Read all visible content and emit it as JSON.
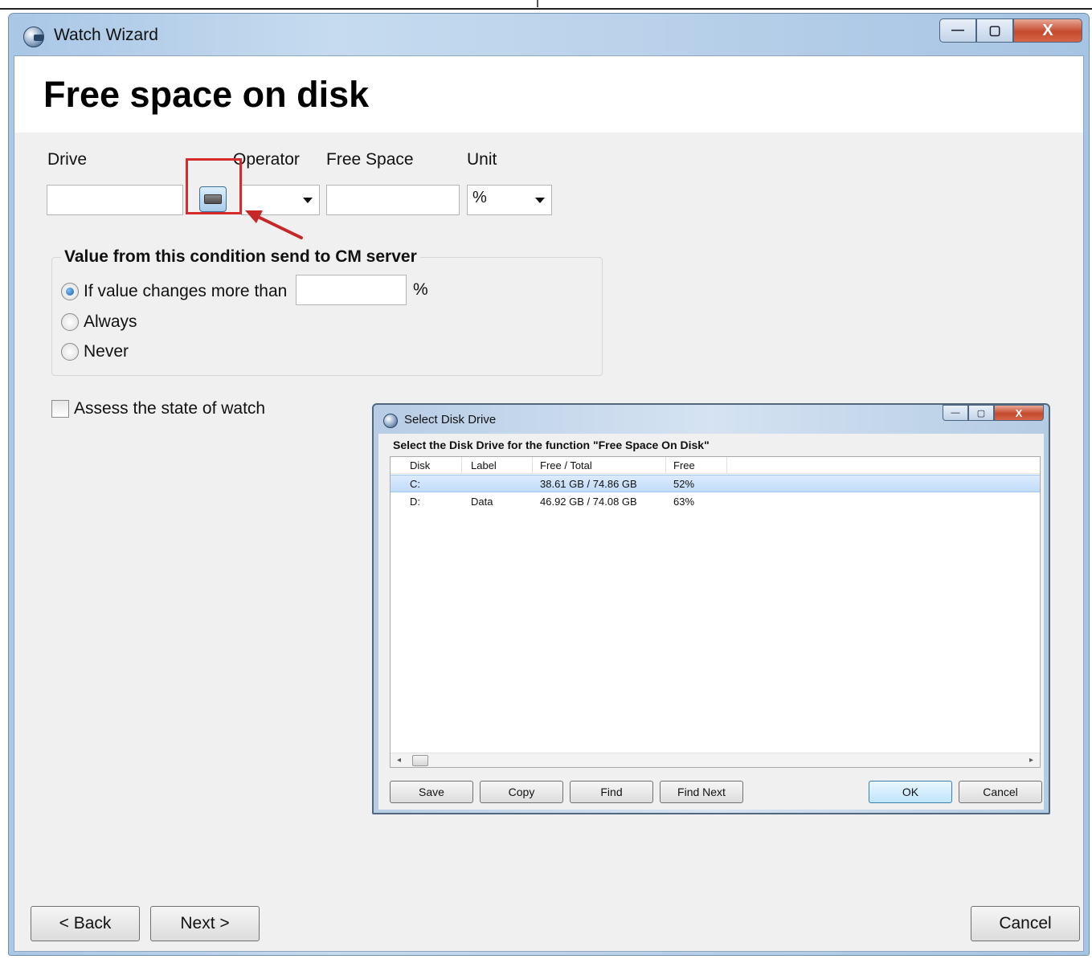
{
  "window": {
    "title": "Watch Wizard",
    "minimize": "—",
    "maximize": "▢",
    "close": "X"
  },
  "page": {
    "title": "Free space on disk"
  },
  "fields": {
    "drive_label": "Drive",
    "drive_value": "",
    "operator_label": "Operator",
    "operator_value": "",
    "free_space_label": "Free Space",
    "free_space_value": "",
    "unit_label": "Unit",
    "unit_value": "%"
  },
  "send_group": {
    "legend": "Value from this condition send to CM server",
    "options": [
      {
        "label": "If value changes more than",
        "selected": true
      },
      {
        "label": "Always",
        "selected": false
      },
      {
        "label": "Never",
        "selected": false
      }
    ],
    "threshold_value": "",
    "threshold_unit": "%"
  },
  "assess_checkbox": {
    "label": "Assess the state of watch",
    "checked": false
  },
  "dialog": {
    "title": "Select Disk Drive",
    "heading": "Select the Disk Drive for the function \"Free Space On Disk\"",
    "columns": [
      "Disk",
      "Label",
      "Free / Total",
      "Free"
    ],
    "rows": [
      {
        "disk": "C:",
        "label": "",
        "free_total": "38.61 GB / 74.86 GB",
        "free": "52%",
        "selected": true
      },
      {
        "disk": "D:",
        "label": "Data",
        "free_total": "46.92 GB / 74.08 GB",
        "free": "63%",
        "selected": false
      }
    ],
    "buttons": {
      "save": "Save",
      "copy": "Copy",
      "find": "Find",
      "find_next": "Find Next",
      "ok": "OK",
      "cancel": "Cancel"
    },
    "scroll_left": "◂",
    "scroll_right": "▸"
  },
  "nav": {
    "back": "< Back",
    "next": "Next >",
    "cancel": "Cancel"
  },
  "colors": {
    "highlight": "#d52b2b",
    "titlebar": "#b9d1ea",
    "close_button": "#c44a2c"
  }
}
